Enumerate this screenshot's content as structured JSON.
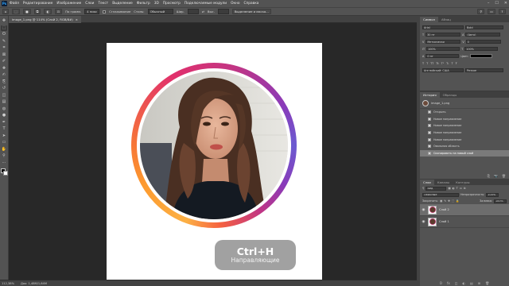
{
  "menubar": {
    "items": [
      "Файл",
      "Редактирование",
      "Изображение",
      "Слои",
      "Текст",
      "Выделение",
      "Фильтр",
      "3D",
      "Просмотр",
      "Подключаемые модули",
      "Окно",
      "Справка"
    ],
    "window_controls": [
      "–",
      "☐",
      "✕"
    ]
  },
  "optbar": {
    "sample_label": "По грамм.",
    "size_value": "4 пикс",
    "antialias_label": "Сглаживание",
    "style_label": "Стиль:",
    "style_value": "Обычный",
    "width_label": "Шир.",
    "height_label": "Выс.",
    "select_mask_label": "Выделение и маска..."
  },
  "document_tab": {
    "title": "image_1.png @ 114% (Слой 2, RGB/8#)",
    "close": "×"
  },
  "tools": [
    "move-icon",
    "marquee-icon",
    "lasso-icon",
    "quick-select-icon",
    "crop-icon",
    "frame-icon",
    "eyedropper-icon",
    "healing-icon",
    "brush-icon",
    "stamp-icon",
    "history-brush-icon",
    "eraser-icon",
    "gradient-icon",
    "blur-icon",
    "dodge-icon",
    "pen-icon",
    "type-icon",
    "path-select-icon",
    "shape-icon",
    "hand-icon",
    "zoom-icon",
    "more-icon"
  ],
  "tool_glyphs": [
    "✥",
    "⬚",
    "ʘ",
    "✎",
    "⌗",
    "⊠",
    "✐",
    "✚",
    "✍",
    "⎘",
    "↺",
    "◫",
    "▤",
    "◍",
    "●",
    "✒",
    "T",
    "➤",
    "▭",
    "✋",
    "⚲",
    "⋯"
  ],
  "shortcut": {
    "keys": "Ctrl+H",
    "description": "Направляющие"
  },
  "statusbar": {
    "zoom": "112,38%",
    "doc_info": "Док: 1,48М/1,64М"
  },
  "char_panel": {
    "tabs": [
      "Символ",
      "Абзац"
    ],
    "font": "Arial",
    "style": "Bold",
    "size": "30 пт",
    "leading": "(Авто)",
    "kerning": "Метрически",
    "tracking": "0",
    "scale_v": "100%",
    "scale_h": "100%",
    "baseline": "0 пт",
    "color_label": "Цвет:",
    "lang": "Английский: США",
    "aa": "Резкое"
  },
  "history_panel": {
    "tabs": [
      "История",
      "Образцы"
    ],
    "snapshot": "image_1.png",
    "items": [
      "Открыть",
      "Новое направление",
      "Новое направление",
      "Новое направление",
      "Новое направление",
      "Овальная область",
      "Скопировать на новый слой"
    ],
    "selected_index": 6,
    "footer": [
      "⎘",
      "📷",
      "🗑"
    ]
  },
  "layers_panel": {
    "tabs": [
      "Слои",
      "Каналы",
      "Контуры"
    ],
    "kind_label": "Вид",
    "blend_mode": "Обычные",
    "opacity_label": "Непрозрачность:",
    "opacity_value": "100%",
    "lock_label": "Закрепить:",
    "fill_label": "Заливка:",
    "fill_value": "100%",
    "layers": [
      {
        "name": "Слой 2",
        "selected": true
      },
      {
        "name": "Слой 1",
        "selected": false
      }
    ],
    "footer": [
      "ʘ",
      "fx",
      "◫",
      "◐",
      "▤",
      "⊞",
      "🗑"
    ]
  }
}
